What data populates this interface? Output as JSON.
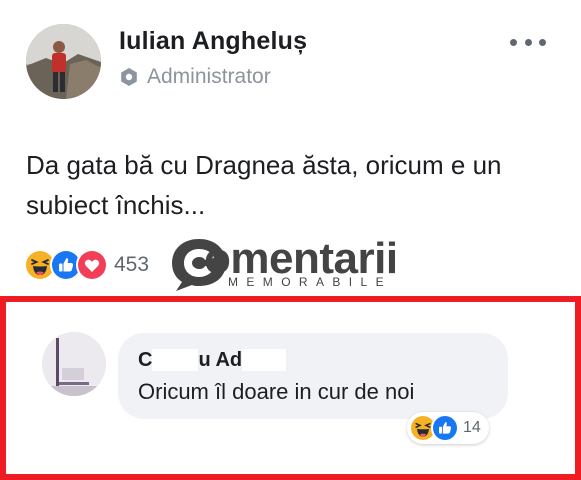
{
  "post": {
    "author": "Iulian Angheluș",
    "role": "Administrator",
    "role_icon": "admin-badge-icon",
    "more_icon": "more-options-icon",
    "text": "Da gata bă cu Dragnea ăsta, oricum e un subiect închis...",
    "reactions": [
      "haha",
      "like",
      "love"
    ],
    "reaction_count": "453"
  },
  "watermark": {
    "word": "omentarii",
    "subtitle": "MEMORABILE",
    "color": "#444444"
  },
  "comment": {
    "name_start": "C",
    "name_middle": "u Ad",
    "text": "Oricum îl doare in cur de noi",
    "reactions": [
      "haha",
      "like"
    ],
    "reaction_count": "14"
  },
  "colors": {
    "highlight_border": "#ef1c24",
    "like_blue": "#1877f2",
    "love_red": "#f33e58",
    "haha_yellow": "#f7b125",
    "bubble_bg": "#f0f2f5",
    "secondary_text": "#8d949e"
  }
}
